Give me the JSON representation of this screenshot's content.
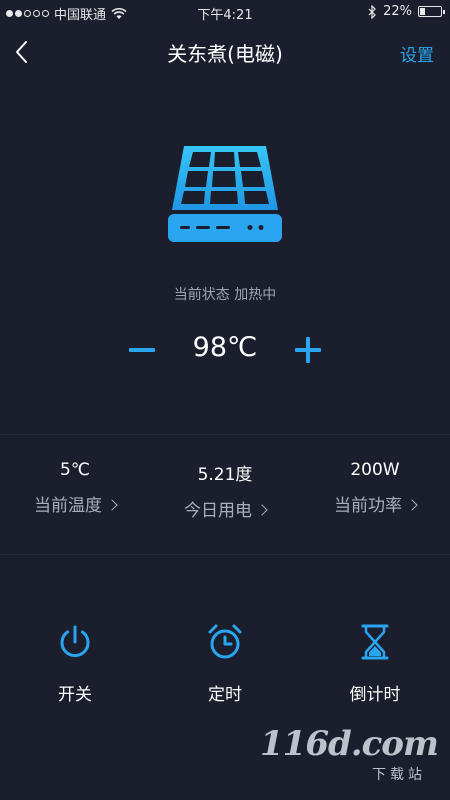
{
  "status_bar": {
    "carrier": "中国联通",
    "time": "下午4:21",
    "battery_percent": "22%",
    "battery_level": 0.22,
    "icons": [
      "signal-icon",
      "wifi-icon",
      "bluetooth-icon",
      "battery-icon"
    ]
  },
  "nav": {
    "title": "关东煮(电磁)",
    "settings_label": "设置",
    "back_icon": "chevron-left-icon"
  },
  "device": {
    "icon": "induction-cooker-icon",
    "state_label": "当前状态",
    "state_value": "加热中"
  },
  "temperature": {
    "value": "98℃",
    "minus_icon": "minus-icon",
    "plus_icon": "plus-icon"
  },
  "stats": [
    {
      "value": "5℃",
      "label": "当前温度"
    },
    {
      "value": "5.21度",
      "label": "今日用电"
    },
    {
      "value": "200W",
      "label": "当前功率"
    }
  ],
  "controls": [
    {
      "label": "开关",
      "icon": "power-icon"
    },
    {
      "label": "定时",
      "icon": "alarm-clock-icon"
    },
    {
      "label": "倒计时",
      "icon": "hourglass-icon"
    }
  ],
  "watermark": {
    "logo": "116d.com",
    "sub": "下载站"
  },
  "colors": {
    "background": "#1b1f2d",
    "accent": "#2aa5f0",
    "text": "#ffffff",
    "muted": "#9ea4b3"
  }
}
